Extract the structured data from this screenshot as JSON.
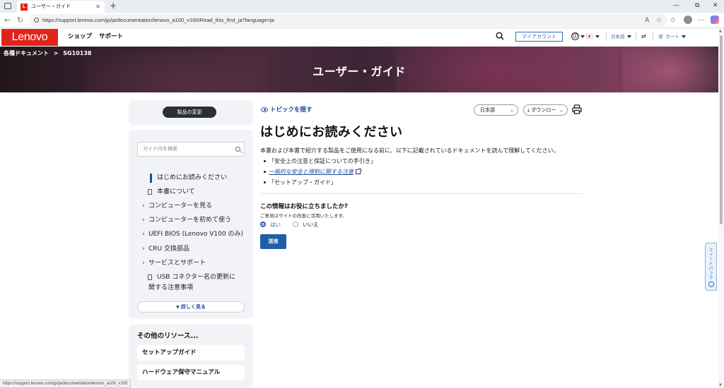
{
  "browser": {
    "tab_title": "ユーザー・ガイド",
    "tab_favicon": "L",
    "url": "https://support.lenovo.com/jp/ja/documentation/lenovo_a100_v100/Read_this_first_ja?language=ja",
    "status_url": "https://support.lenovo.com/jp/ja/documentation/lenovo_a100_v100",
    "new_tab": "+",
    "close_tab": "✕",
    "minimize": "—",
    "restore": "⧉",
    "close_window": "✕"
  },
  "header": {
    "logo": "Lenovo",
    "nav": [
      "ショップ",
      "サポート"
    ],
    "my_account": "マイアカウント",
    "language": "日本語",
    "cart": "カート"
  },
  "hero": {
    "breadcrumb_root": "各種ドキュメント",
    "breadcrumb_sep": ">",
    "breadcrumb_doc": "SG10138",
    "title": "ユーザー・ガイド"
  },
  "sidebar": {
    "change_product": "製品の変更",
    "search_placeholder": "ガイド内を検索",
    "toc": [
      {
        "label": "はじめにお読みください"
      },
      {
        "label": "本書について"
      },
      {
        "label": "コンピューターを見る"
      },
      {
        "label": "コンピューターを初めて使う"
      },
      {
        "label": "UEFI BIOS (Lenovo V100 のみ)"
      },
      {
        "label": "CRU 交換部品"
      },
      {
        "label": "サービスとサポート"
      },
      {
        "label_line1": "USB コネクター名の更新に",
        "label_line2": "関する注意事項"
      }
    ],
    "more": "詳しく見る",
    "resources_title": "その他のリソース...",
    "resources": [
      "セットアップガイド",
      "ハードウェア保守マニュアル"
    ]
  },
  "main": {
    "hide_topics": "トピックを隠す",
    "language_select": "日本語",
    "download_select": "ダウンロー",
    "title": "はじめにお読みください",
    "intro": "本書および本書で紹介する製品をご使用になる前に、以下に記載されているドキュメントを読んで理解してください。",
    "bullets": [
      "「安全上の注意と保証についての手引き」",
      "一般的な安全と規制に関する注意",
      "「セットアップ・ガイド」"
    ],
    "feedback_question": "この情報はお役に立ちましたか?",
    "feedback_sub": "ご意見はサイトの改善に活用いたします。",
    "yes": "はい",
    "no": "いいえ",
    "submit": "送信"
  },
  "feedback_tab": "フィードバック",
  "colors": {
    "lenovo_red": "#e2231a",
    "link_blue": "#1f4e9c",
    "button_blue": "#1f5fa8"
  }
}
